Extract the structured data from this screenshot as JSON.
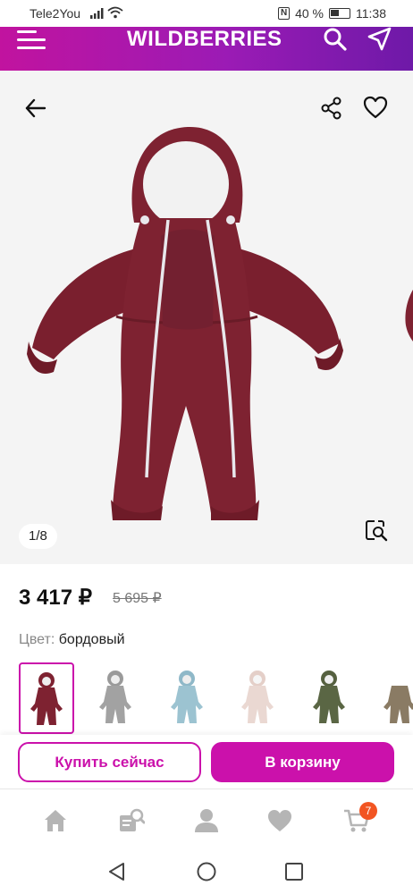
{
  "status_bar": {
    "carrier": "Tele2You",
    "battery": "40 %",
    "time": "11:38",
    "nfc": "N"
  },
  "header": {
    "logo": "WILDBERRIES"
  },
  "gallery": {
    "counter": "1/8"
  },
  "product": {
    "price": "3 417 ₽",
    "old_price": "5 695 ₽",
    "color_label": "Цвет:",
    "color_value": "бордовый",
    "swatches": [
      "бордовый",
      "серый",
      "голубой",
      "розовый",
      "хаки",
      "бежевый"
    ]
  },
  "actions": {
    "buy_now": "Купить сейчас",
    "add_to_cart": "В корзину"
  },
  "bottom_nav": {
    "cart_badge": "7"
  },
  "colors": {
    "brand": "#cb11ab",
    "header_gradient": [
      "#c1139f",
      "#6e19a8"
    ],
    "product": "#7e2231",
    "badge": "#f25522"
  }
}
